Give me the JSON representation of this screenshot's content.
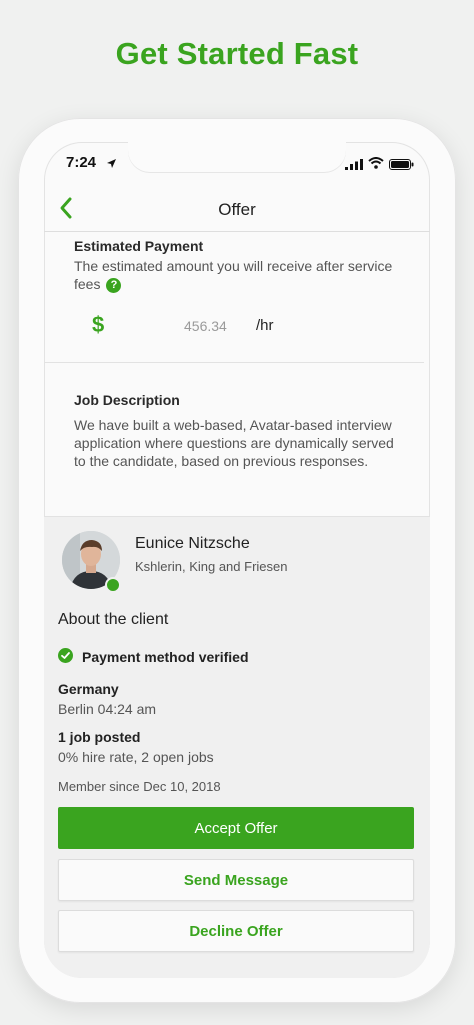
{
  "headline": "Get Started Fast",
  "status_bar": {
    "time": "7:24"
  },
  "nav": {
    "title": "Offer"
  },
  "payment": {
    "heading": "Estimated Payment",
    "description": "The estimated amount you will receive after service fees",
    "currency_symbol": "$",
    "amount": "456.34",
    "unit": "/hr",
    "help_glyph": "?"
  },
  "job": {
    "heading": "Job Description",
    "text": "We have built a web-based, Avatar-based interview application where questions are dynamically served to the candidate, based on previous responses."
  },
  "client": {
    "name": "Eunice Nitzsche",
    "company": "Kshlerin, King and Friesen",
    "about_label": "About the client",
    "verified_label": "Payment method verified",
    "country": "Germany",
    "local_time": "Berlin 04:24 am",
    "jobs_posted": "1 job posted",
    "hire_stats": "0% hire rate, 2 open jobs",
    "member_since": "Member since Dec 10, 2018"
  },
  "actions": {
    "accept": "Accept Offer",
    "message": "Send Message",
    "decline": "Decline Offer"
  },
  "colors": {
    "brand_green": "#3aa41f",
    "background": "#f0f1f0"
  },
  "icons": [
    "location-arrow-icon",
    "cellular-signal-icon",
    "wifi-icon",
    "battery-icon",
    "back-chevron-icon",
    "help-icon",
    "verified-check-icon"
  ]
}
